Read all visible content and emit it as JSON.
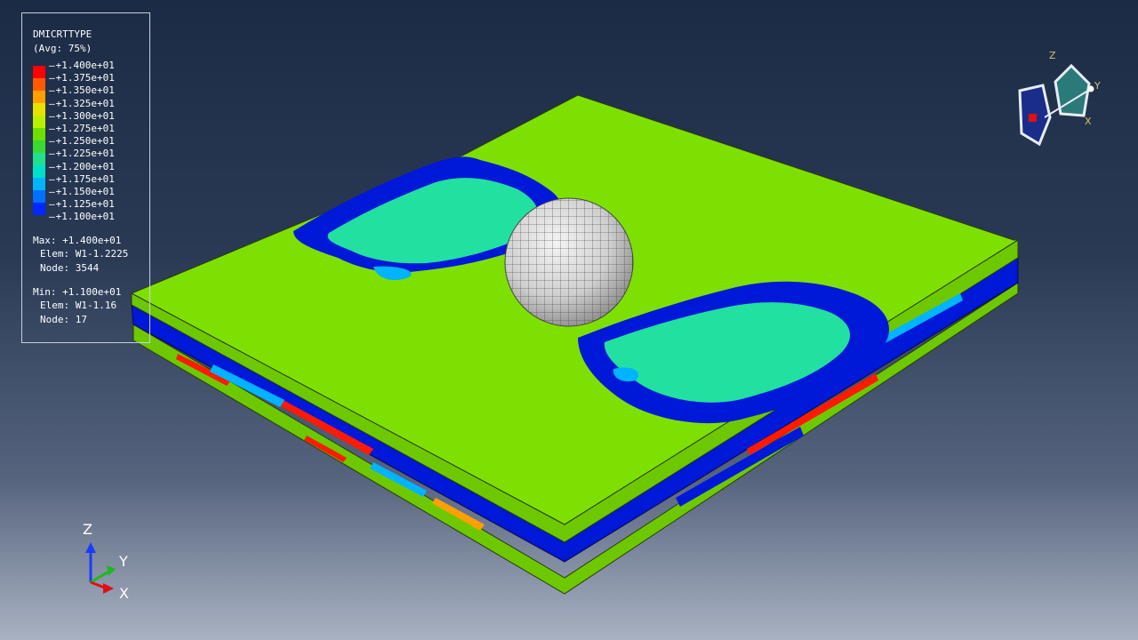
{
  "legend": {
    "title": "DMICRTTYPE",
    "avg": "(Avg: 75%)",
    "ticks": [
      "+1.400e+01",
      "+1.375e+01",
      "+1.350e+01",
      "+1.325e+01",
      "+1.300e+01",
      "+1.275e+01",
      "+1.250e+01",
      "+1.225e+01",
      "+1.200e+01",
      "+1.175e+01",
      "+1.150e+01",
      "+1.125e+01",
      "+1.100e+01"
    ],
    "colors": [
      "#ff0000",
      "#ff5a00",
      "#ffa000",
      "#e8e000",
      "#b8f000",
      "#6ee000",
      "#3ad830",
      "#20e090",
      "#00e0c8",
      "#00b4ff",
      "#0070ff",
      "#0028ff"
    ],
    "max": "Max: +1.400e+01",
    "max_elem": "Elem: W1-1.2225",
    "max_node": "Node: 3544",
    "min": "Min: +1.100e+01",
    "min_elem": "Elem: W1-1.16",
    "min_node": "Node: 17"
  },
  "triad": {
    "z": "Z",
    "y": "Y",
    "x": "X"
  },
  "view_cube": {
    "z": "Z",
    "y": "Y",
    "x": "X"
  },
  "colors": {
    "plate_top": "#7ee000",
    "plate_side": "#6dc800",
    "blue_band": "#0018d8",
    "cyan_green": "#22e0a0",
    "cyan": "#00b4ff",
    "red": "#ff1a00",
    "sphere": "#d8d8d8"
  }
}
